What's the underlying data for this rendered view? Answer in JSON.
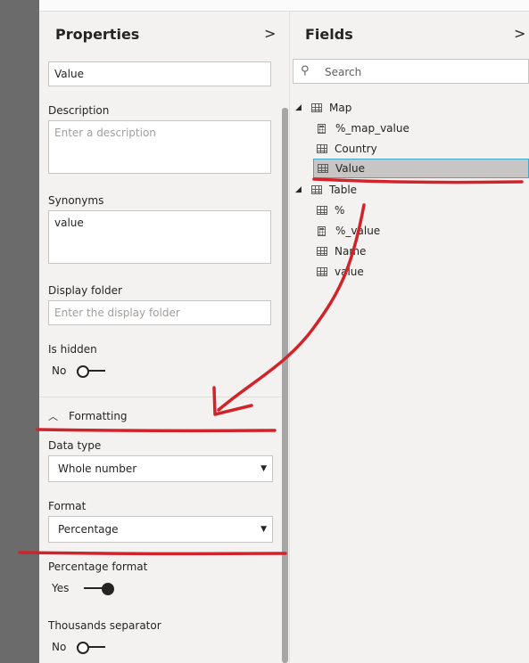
{
  "properties": {
    "title": "Properties",
    "chevron": ">",
    "name_value": "Value",
    "description_label": "Description",
    "description_placeholder": "Enter a description",
    "synonyms_label": "Synonyms",
    "synonyms_value": "value",
    "display_folder_label": "Display folder",
    "display_folder_placeholder": "Enter the display folder",
    "is_hidden_label": "Is hidden",
    "is_hidden_value": "No",
    "formatting_label": "Formatting",
    "data_type_label": "Data type",
    "data_type_value": "Whole number",
    "format_label": "Format",
    "format_value": "Percentage",
    "percentage_format_label": "Percentage format",
    "percentage_format_value": "Yes",
    "thousands_label": "Thousands separator",
    "thousands_value": "No"
  },
  "fields": {
    "title": "Fields",
    "chevron": ">",
    "search_placeholder": "Search",
    "tables": [
      {
        "name": "Map",
        "items": [
          "%_map_value",
          "Country",
          "Value"
        ]
      },
      {
        "name": "Table",
        "items": [
          "%",
          "%_value",
          "Name",
          "value"
        ]
      }
    ]
  },
  "colors": {
    "annotation": "#d2232a",
    "selection_border": "#40a8c8"
  }
}
